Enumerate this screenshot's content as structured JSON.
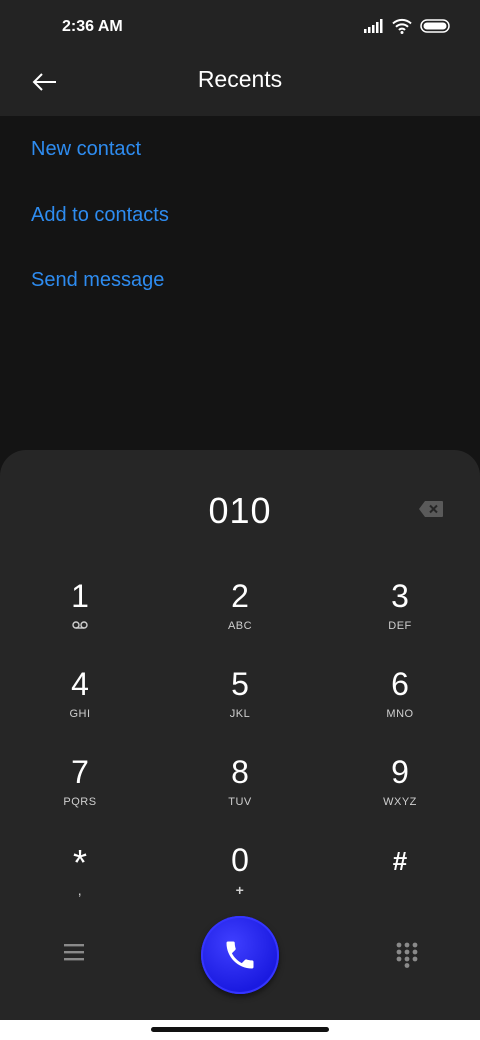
{
  "status_bar": {
    "time": "2:36 AM",
    "icons": [
      "signal-icon",
      "wifi-icon",
      "battery-icon"
    ]
  },
  "header": {
    "back_icon": "back-arrow-icon",
    "title": "Recents"
  },
  "actions": [
    {
      "label": "New contact"
    },
    {
      "label": "Add to contacts"
    },
    {
      "label": "Send message"
    }
  ],
  "dialer": {
    "number": "010",
    "backspace_icon": "backspace-icon",
    "keys": [
      {
        "digit": "1",
        "letters": "",
        "icon": "voicemail-icon"
      },
      {
        "digit": "2",
        "letters": "ABC"
      },
      {
        "digit": "3",
        "letters": "DEF"
      },
      {
        "digit": "4",
        "letters": "GHI"
      },
      {
        "digit": "5",
        "letters": "JKL"
      },
      {
        "digit": "6",
        "letters": "MNO"
      },
      {
        "digit": "7",
        "letters": "PQRS"
      },
      {
        "digit": "8",
        "letters": "TUV"
      },
      {
        "digit": "9",
        "letters": "WXYZ"
      },
      {
        "digit": "*",
        "letters": ","
      },
      {
        "digit": "0",
        "letters": "+"
      },
      {
        "digit": "#",
        "letters": ""
      }
    ],
    "bottom": {
      "menu_icon": "menu-icon",
      "call_icon": "phone-icon",
      "keypad_icon": "keypad-icon"
    }
  },
  "colors": {
    "accent": "#2e8cf0",
    "call_button": "#2222ee",
    "background": "#141414",
    "panel": "#262626"
  }
}
